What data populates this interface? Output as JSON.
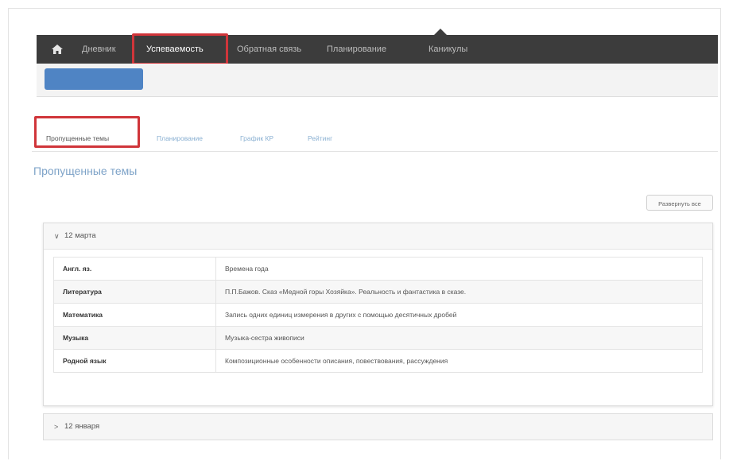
{
  "nav": {
    "items": [
      {
        "label": "Дневник",
        "active": false
      },
      {
        "label": "Успеваемость",
        "active": true
      },
      {
        "label": "Обратная связь",
        "active": false
      },
      {
        "label": "Планирование",
        "active": false
      },
      {
        "label": "Каникулы",
        "active": false
      }
    ],
    "home_icon": "home-icon",
    "bar_color": "#3c3c3c",
    "highlight_color": "#d0353a"
  },
  "subbar": {
    "button_color": "#4f84c4"
  },
  "tabs": [
    {
      "label": "Пропущенные темы",
      "active": true
    },
    {
      "label": "Планирование",
      "active": false
    },
    {
      "label": "График КР",
      "active": false
    },
    {
      "label": "Рейтинг",
      "active": false
    }
  ],
  "section_title": "Пропущенные темы",
  "expand_all_label": "Развернуть все",
  "panels": [
    {
      "title": "12 марта",
      "expanded": true,
      "rows": [
        {
          "subject": "Англ. яз.",
          "topic": "Времена года"
        },
        {
          "subject": "Литература",
          "topic": "П.П.Бажов. Сказ «Медной горы Хозяйка». Реальность и фантастика в сказе."
        },
        {
          "subject": "Математика",
          "topic": "Запись одних единиц измерения в других с помощью десятичных дробей"
        },
        {
          "subject": "Музыка",
          "topic": "Музыка-сестра живописи"
        },
        {
          "subject": "Родной язык",
          "topic": "Композиционные особенности описания, повествования, рассуждения"
        }
      ]
    },
    {
      "title": "12 января",
      "expanded": false
    }
  ]
}
